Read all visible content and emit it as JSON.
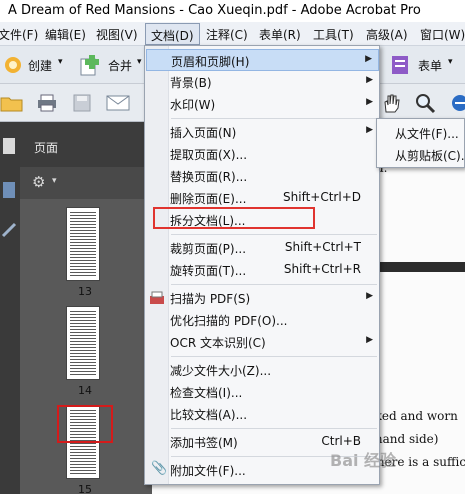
{
  "window": {
    "title": "A Dream of Red Mansions - Cao Xueqin.pdf - Adobe Acrobat Pro"
  },
  "menubar": {
    "items": [
      "文件(F)",
      "编辑(E)",
      "视图(V)",
      "文档(D)",
      "注释(C)",
      "表单(R)",
      "工具(T)",
      "高级(A)",
      "窗口(W)"
    ],
    "active": "文档(D)"
  },
  "toolbar": {
    "create_label": "创建",
    "combine_label": "合并",
    "forms_label": "表单"
  },
  "panel": {
    "title": "页面"
  },
  "thumbnails": [
    {
      "page": "13",
      "selected": false
    },
    {
      "page": "14",
      "selected": false
    },
    {
      "page": "15",
      "selected": true
    }
  ],
  "document_text": {
    "line1": "d.",
    "line2": "racked and worn",
    "line3": "t-hand side)",
    "line4": "there is a suffic"
  },
  "document_menu": {
    "items": [
      {
        "label": "页眉和页脚(H)",
        "submenu": true,
        "highlighted": true
      },
      {
        "label": "背景(B)",
        "submenu": true
      },
      {
        "label": "水印(W)",
        "submenu": true
      },
      {
        "label": "插入页面(N)",
        "submenu": true
      },
      {
        "label": "提取页面(X)..."
      },
      {
        "label": "替换页面(R)..."
      },
      {
        "label": "删除页面(E)...",
        "shortcut": "Shift+Ctrl+D"
      },
      {
        "label": "拆分文档(L)...",
        "outlined": true
      },
      {
        "label": "裁剪页面(P)...",
        "shortcut": "Shift+Ctrl+T"
      },
      {
        "label": "旋转页面(T)...",
        "shortcut": "Shift+Ctrl+R"
      },
      {
        "label": "扫描为 PDF(S)",
        "submenu": true,
        "icon": "scan-icon"
      },
      {
        "label": "优化扫描的 PDF(O)..."
      },
      {
        "label": "OCR 文本识别(C)",
        "submenu": true
      },
      {
        "label": "减少文件大小(Z)..."
      },
      {
        "label": "检查文档(I)..."
      },
      {
        "label": "比较文档(A)..."
      },
      {
        "label": "添加书签(M)",
        "shortcut": "Ctrl+B"
      },
      {
        "label": "附加文件(F)...",
        "icon": "paperclip-icon"
      }
    ]
  },
  "insert_submenu": {
    "items": [
      "从文件(F)...",
      "从剪贴板(C)..."
    ]
  },
  "watermark_text": "Bai 经验",
  "colors": {
    "highlight": "#c8ddf6",
    "annotation_red": "#e0342f",
    "panel_dark": "#3c3c3c"
  }
}
